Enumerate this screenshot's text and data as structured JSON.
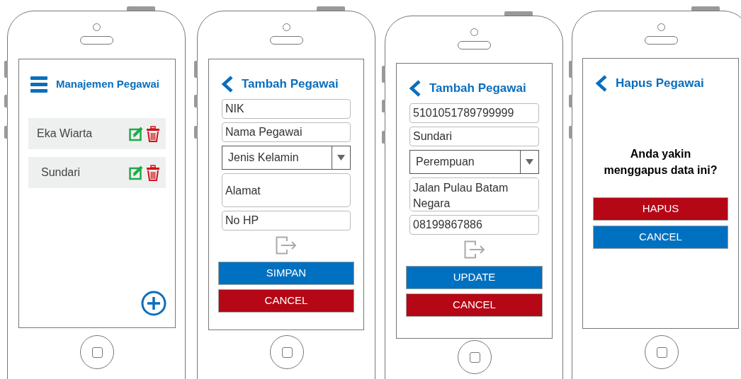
{
  "screens": [
    {
      "kind": "list",
      "title": "Manajemen Pegawai",
      "items": [
        {
          "name": "Eka Wiarta"
        },
        {
          "name": "Sundari"
        }
      ]
    },
    {
      "kind": "form",
      "title": "Tambah Pegawai",
      "fields": [
        {
          "kind": "text",
          "placeholder": "NIK"
        },
        {
          "kind": "text",
          "placeholder": "Nama Pegawai"
        },
        {
          "kind": "select",
          "value": "Jenis Kelamin"
        },
        {
          "kind": "area",
          "placeholder": "Alamat"
        },
        {
          "kind": "text",
          "placeholder": "No HP"
        }
      ],
      "buttons": [
        {
          "label": "SIMPAN",
          "color": "#0070c0"
        },
        {
          "label": "CANCEL",
          "color": "#b50715"
        }
      ]
    },
    {
      "kind": "form",
      "title": "Tambah Pegawai",
      "fields": [
        {
          "kind": "text",
          "value": "5101051789799999"
        },
        {
          "kind": "text",
          "value": "Sundari"
        },
        {
          "kind": "select",
          "value": "Perempuan"
        },
        {
          "kind": "area",
          "value": "Jalan Pulau Batam\nNegara"
        },
        {
          "kind": "text",
          "value": "08199867886"
        }
      ],
      "buttons": [
        {
          "label": "UPDATE",
          "color": "#0070c0"
        },
        {
          "label": "CANCEL",
          "color": "#b50715"
        }
      ]
    },
    {
      "kind": "confirm",
      "title": "Hapus Pegawai",
      "message": "Anda yakin menggapus data ini?",
      "buttons": [
        {
          "label": "HAPUS",
          "color": "#b50715"
        },
        {
          "label": "CANCEL",
          "color": "#0070c0"
        }
      ]
    }
  ]
}
